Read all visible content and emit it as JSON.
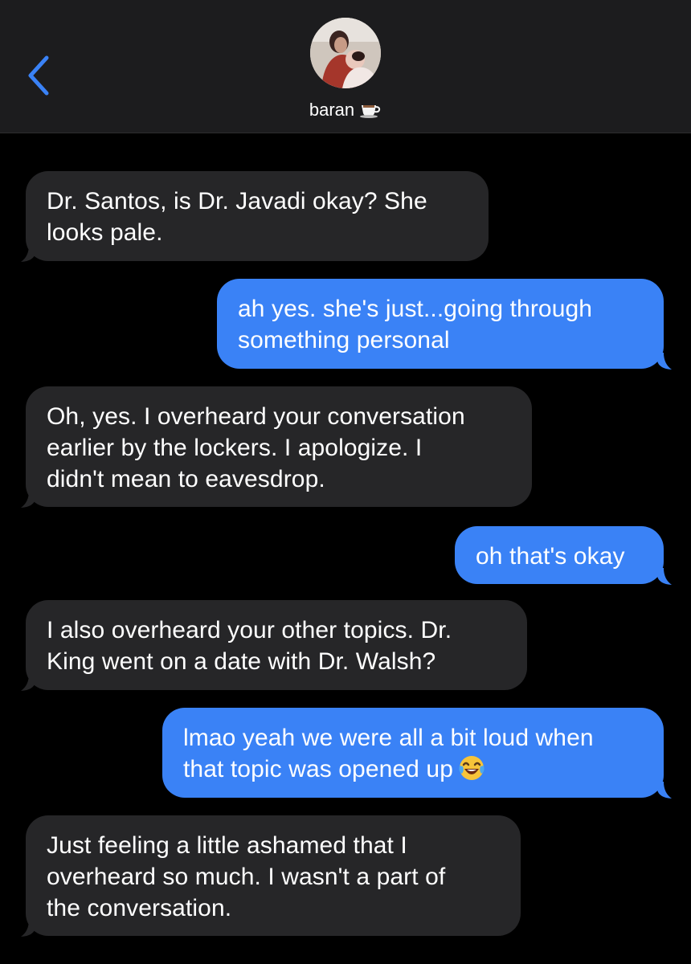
{
  "header": {
    "contact_name": "baran",
    "contact_emoji_icon": "coffee-cup-icon",
    "back_icon": "chevron-left-icon"
  },
  "colors": {
    "header_bg": "#1c1c1e",
    "incoming_bubble": "#262628",
    "outgoing_bubble": "#3a82f6",
    "accent": "#3a82f6",
    "background": "#000000"
  },
  "messages": [
    {
      "from": "them",
      "lines": [
        "Dr. Santos, is Dr. Javadi okay? She",
        "looks pale."
      ]
    },
    {
      "from": "me",
      "lines": [
        "ah yes. she's just...going through",
        "something personal"
      ]
    },
    {
      "from": "them",
      "lines": [
        "Oh, yes. I overheard your conversation",
        "earlier by the lockers. I apologize. I",
        "didn't mean to eavesdrop."
      ]
    },
    {
      "from": "me",
      "lines": [
        "oh that's okay"
      ]
    },
    {
      "from": "them",
      "lines": [
        "I also overheard your other topics. Dr.",
        "King went on a date with Dr. Walsh?"
      ]
    },
    {
      "from": "me",
      "lines": [
        "lmao yeah we were all a bit loud when",
        "that topic was opened up"
      ],
      "trailing_icon": "tears-of-joy-emoji-icon"
    },
    {
      "from": "them",
      "lines": [
        "Just feeling a little ashamed that I",
        "overheard so much. I wasn't a part of",
        "the conversation."
      ]
    }
  ]
}
